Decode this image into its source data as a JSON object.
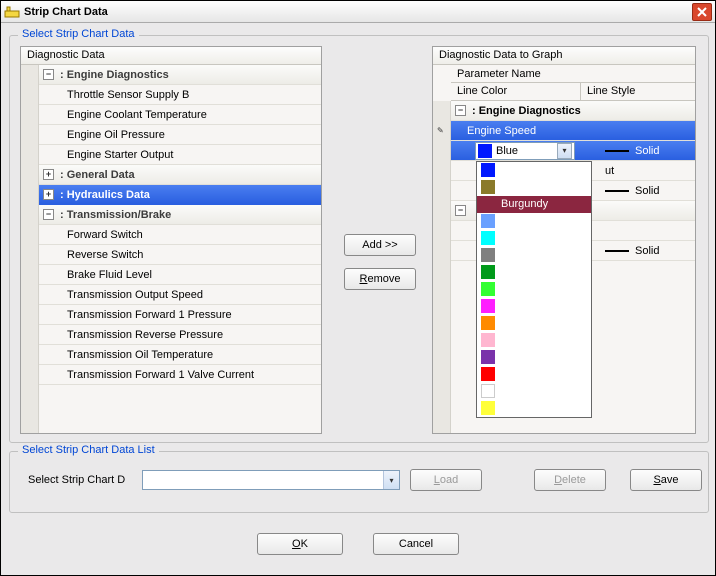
{
  "window": {
    "title": "Strip Chart Data"
  },
  "select_panel": {
    "legend": "Select Strip Chart Data"
  },
  "left": {
    "header": "Diagnostic Data",
    "groups": [
      {
        "label": ": Engine Diagnostics",
        "expanded": true,
        "children": [
          "Throttle Sensor Supply B",
          "Engine Coolant Temperature",
          "Engine Oil Pressure",
          "Engine Starter Output"
        ]
      },
      {
        "label": ": General Data",
        "expanded": false,
        "children": []
      },
      {
        "label": ": Hydraulics Data",
        "expanded": false,
        "children": [],
        "selected": true
      },
      {
        "label": ": Transmission/Brake",
        "expanded": true,
        "children": [
          "Forward Switch",
          "Reverse Switch",
          "Brake Fluid Level",
          "Transmission Output Speed",
          "Transmission Forward 1 Pressure",
          "Transmission Reverse Pressure",
          "Transmission Oil Temperature",
          "Transmission Forward 1 Valve Current"
        ]
      }
    ]
  },
  "buttons": {
    "add": "Add >>",
    "remove_u": "R",
    "remove_rest": "emove",
    "load_u": "L",
    "load_rest": "oad",
    "delete_u": "D",
    "delete_rest": "elete",
    "save_u": "S",
    "save_rest": "ave",
    "ok_u": "O",
    "ok_rest": "K",
    "cancel": "Cancel"
  },
  "right": {
    "header": "Diagnostic Data to Graph",
    "paramName": "Parameter Name",
    "lineColor": "Line Color",
    "lineStyle": "Line Style",
    "group0": ": Engine Diagnostics",
    "engineSpeed": "Engine Speed",
    "combo_value": "Blue",
    "solid": "Solid",
    "row3_right": "ut",
    "group_partial": "e",
    "colors": [
      {
        "name": "Blue",
        "hex": "#0018ff"
      },
      {
        "name": "Brown",
        "hex": "#8a7a2a"
      },
      {
        "name": "Burgundy",
        "hex": "#8b2640",
        "selected": true
      },
      {
        "name": "Corn Flower",
        "hex": "#6aa0ff"
      },
      {
        "name": "Cyan",
        "hex": "#00ffff"
      },
      {
        "name": "Gray",
        "hex": "#808080"
      },
      {
        "name": "Green",
        "hex": "#009a1a"
      },
      {
        "name": "Lime",
        "hex": "#32ff32"
      },
      {
        "name": "Magenta",
        "hex": "#ff1eff"
      },
      {
        "name": "Orange",
        "hex": "#ff8a00"
      },
      {
        "name": "Pink",
        "hex": "#ffb6d0"
      },
      {
        "name": "Purple",
        "hex": "#7a32aa"
      },
      {
        "name": "Red",
        "hex": "#ff0000"
      },
      {
        "name": "White",
        "hex": "#ffffff"
      },
      {
        "name": "Yellow",
        "hex": "#ffff3a"
      }
    ],
    "combo_swatch": "#0018ff"
  },
  "list_panel": {
    "legend": "Select Strip Chart Data List",
    "label": "Select Strip Chart D",
    "value": ""
  }
}
